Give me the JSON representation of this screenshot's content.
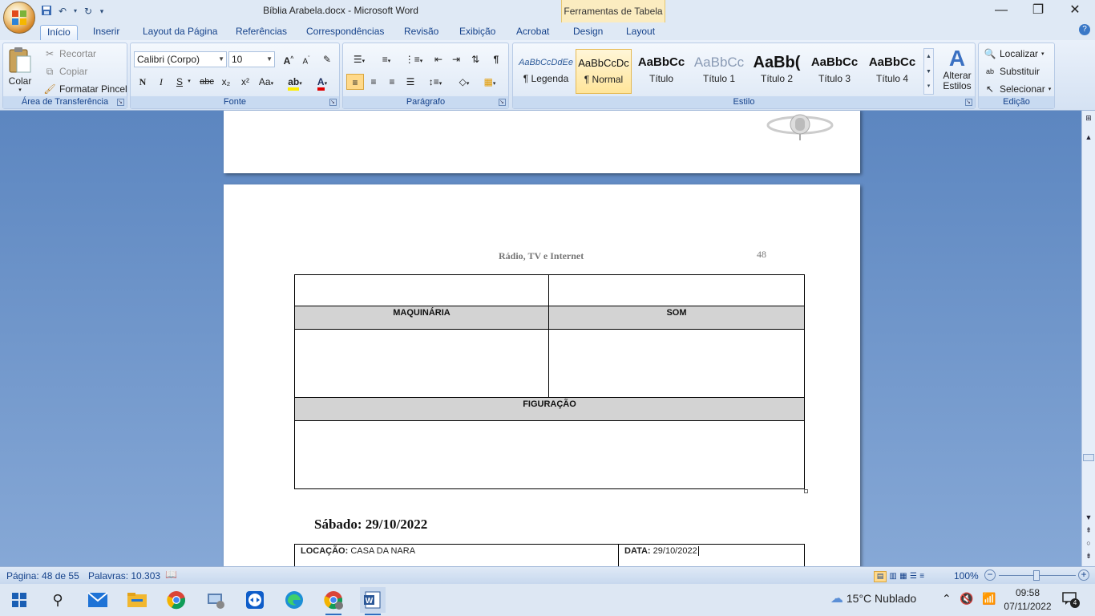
{
  "window": {
    "title": "Bíblia Arabela.docx - Microsoft Word",
    "contextual_group": "Ferramentas de Tabela",
    "minimize": "—",
    "restore": "❐",
    "close": "✕"
  },
  "tabs": [
    {
      "label": "Início",
      "active": true
    },
    {
      "label": "Inserir"
    },
    {
      "label": "Layout da Página"
    },
    {
      "label": "Referências"
    },
    {
      "label": "Correspondências"
    },
    {
      "label": "Revisão"
    },
    {
      "label": "Exibição"
    },
    {
      "label": "Acrobat"
    },
    {
      "label": "Design"
    },
    {
      "label": "Layout"
    }
  ],
  "clipboard": {
    "paste": "Colar",
    "cut": "Recortar",
    "copy": "Copiar",
    "format_painter": "Formatar Pincel",
    "label": "Área de Transferência"
  },
  "font": {
    "name": "Calibri (Corpo)",
    "size": "10",
    "bold": "N",
    "italic": "I",
    "underline": "S",
    "strike": "abc",
    "subscript": "x₂",
    "superscript": "x²",
    "case": "Aa",
    "grow": "A",
    "shrink": "A",
    "label": "Fonte"
  },
  "paragraph": {
    "label": "Parágrafo",
    "pilcrow": "¶"
  },
  "styles": {
    "items": [
      {
        "preview": "AaBbCcDdEe",
        "name": "¶ Legenda"
      },
      {
        "preview": "AaBbCcDc",
        "name": "¶ Normal",
        "selected": true
      },
      {
        "preview": "AaBbCc",
        "name": "Título"
      },
      {
        "preview": "AaBbCc",
        "name": "Título 1"
      },
      {
        "preview": "AaBb(",
        "name": "Título 2"
      },
      {
        "preview": "AaBbCc",
        "name": "Título 3"
      },
      {
        "preview": "AaBbCc",
        "name": "Título 4"
      }
    ],
    "change": "Alterar Estilos",
    "label": "Estilo"
  },
  "editing": {
    "find": "Localizar",
    "replace": "Substituir",
    "select": "Selecionar",
    "label": "Edição"
  },
  "document": {
    "header_text": "Rádio, TV e Internet",
    "page_number": "48",
    "table": {
      "col1_header": "MAQUINÁRIA",
      "col2_header": "SOM",
      "full_header": "FIGURAÇÃO"
    },
    "date_heading": "Sábado: 29/10/2022",
    "location_label": "LOCAÇÃO:",
    "location_value": "CASA DA NARA",
    "date_label": "DATA:",
    "date_value": "29/10/2022"
  },
  "status": {
    "page": "Página: 48 de 55",
    "words": "Palavras: 10.303",
    "zoom": "100%"
  },
  "taskbar": {
    "weather": "15°C  Nublado",
    "time": "09:58",
    "date": "07/11/2022",
    "notifications": "4"
  }
}
